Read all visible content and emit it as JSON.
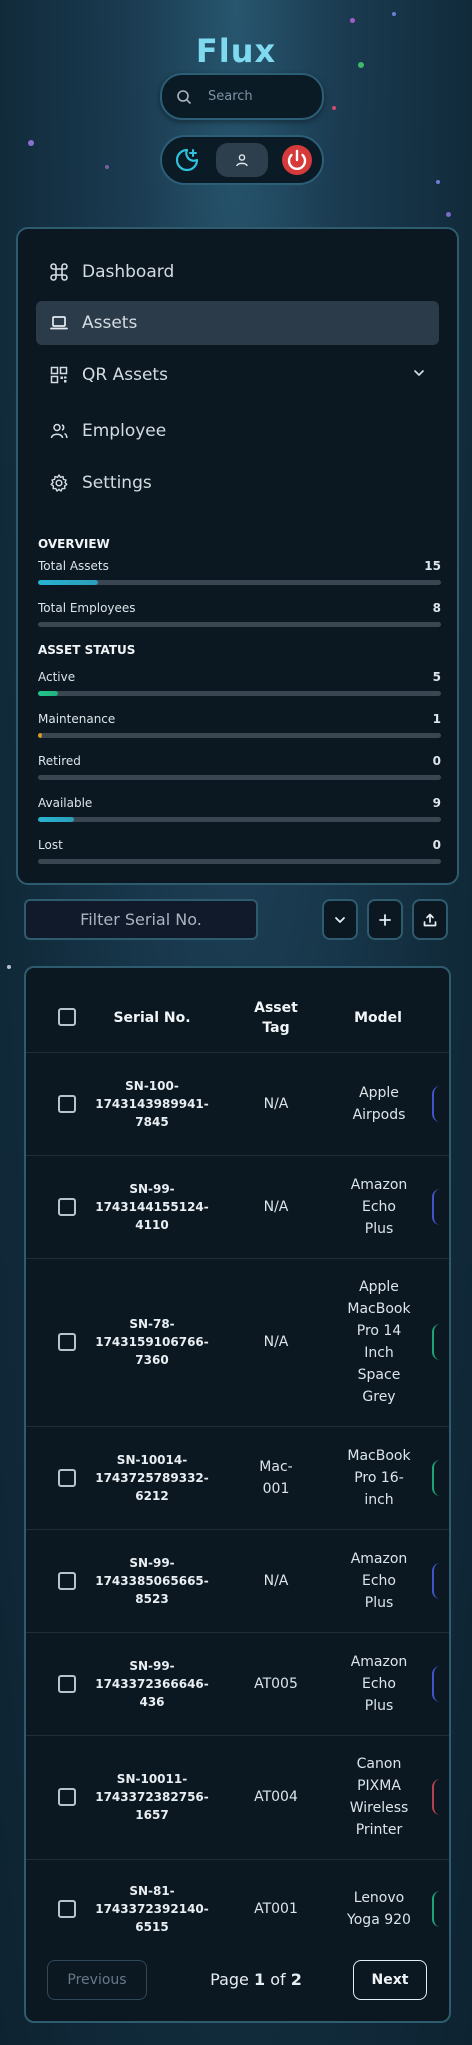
{
  "app": {
    "brand": "Flux"
  },
  "search": {
    "placeholder": "Search"
  },
  "controls": {
    "theme_icon": "moon-plus-icon",
    "profile_icon": "user-icon",
    "power_icon": "power-icon"
  },
  "nav": {
    "items": [
      {
        "label": "Dashboard",
        "icon": "command-icon",
        "active": false
      },
      {
        "label": "Assets",
        "icon": "laptop-icon",
        "active": true
      },
      {
        "label": "QR Assets",
        "icon": "qr-code-icon",
        "active": false,
        "expandable": true
      },
      {
        "label": "Employee",
        "icon": "users-icon",
        "active": false
      },
      {
        "label": "Settings",
        "icon": "gear-icon",
        "active": false
      }
    ]
  },
  "overview": {
    "title": "OVERVIEW",
    "stats": [
      {
        "label": "Total Assets",
        "value": "15",
        "fraction": 0.15,
        "color": "#27b4d3"
      },
      {
        "label": "Total Employees",
        "value": "8",
        "fraction": 0,
        "color": "#27b4d3"
      }
    ]
  },
  "asset_status": {
    "title": "ASSET STATUS",
    "stats": [
      {
        "label": "Active",
        "value": "5",
        "fraction": 0.05,
        "color": "#1fc98a"
      },
      {
        "label": "Maintenance",
        "value": "1",
        "fraction": 0.01,
        "color": "#e8a11b"
      },
      {
        "label": "Retired",
        "value": "0",
        "fraction": 0,
        "color": "#8a8f94"
      },
      {
        "label": "Available",
        "value": "9",
        "fraction": 0.09,
        "color": "#27b4d3"
      },
      {
        "label": "Lost",
        "value": "0",
        "fraction": 0,
        "color": "#e05252"
      }
    ]
  },
  "filter": {
    "placeholder": "Filter Serial No."
  },
  "toolbar": {
    "dropdown_icon": "chevron-down-icon",
    "add_icon": "plus-icon",
    "export_icon": "upload-icon"
  },
  "table": {
    "headers": {
      "serial": "Serial No.",
      "tag_line1": "Asset",
      "tag_line2": "Tag",
      "model": "Model"
    },
    "rows": [
      {
        "serial": [
          "SN-100-",
          "1743143989941-",
          "7845"
        ],
        "tag": [
          "N/A"
        ],
        "model": [
          "Apple",
          "Airpods"
        ],
        "edge": "#4254c8"
      },
      {
        "serial": [
          "SN-99-",
          "1743144155124-",
          "4110"
        ],
        "tag": [
          "N/A"
        ],
        "model": [
          "Amazon",
          "Echo",
          "Plus"
        ],
        "edge": "#4254c8"
      },
      {
        "serial": [
          "SN-78-",
          "1743159106766-",
          "7360"
        ],
        "tag": [
          "N/A"
        ],
        "model": [
          "Apple",
          "MacBook",
          "Pro 14",
          "Inch",
          "Space",
          "Grey"
        ],
        "edge": "#1fa37a"
      },
      {
        "serial": [
          "SN-10014-",
          "1743725789332-",
          "6212"
        ],
        "tag": [
          "Mac-",
          "001"
        ],
        "model": [
          "MacBook",
          "Pro 16-",
          "inch"
        ],
        "edge": "#1fa37a"
      },
      {
        "serial": [
          "SN-99-",
          "1743385065665-",
          "8523"
        ],
        "tag": [
          "N/A"
        ],
        "model": [
          "Amazon",
          "Echo",
          "Plus"
        ],
        "edge": "#4254c8"
      },
      {
        "serial": [
          "SN-99-",
          "1743372366646-",
          "436"
        ],
        "tag": [
          "AT005"
        ],
        "model": [
          "Amazon",
          "Echo",
          "Plus"
        ],
        "edge": "#4254c8"
      },
      {
        "serial": [
          "SN-10011-",
          "1743372382756-",
          "1657"
        ],
        "tag": [
          "AT004"
        ],
        "model": [
          "Canon",
          "PIXMA",
          "Wireless",
          "Printer"
        ],
        "edge": "#b8404e"
      },
      {
        "serial": [
          "SN-81-",
          "1743372392140-",
          "6515"
        ],
        "tag": [
          "AT001"
        ],
        "model": [
          "Lenovo",
          "Yoga 920"
        ],
        "edge": "#1fa37a"
      }
    ]
  },
  "pagination": {
    "previous": "Previous",
    "page_word": "Page",
    "current": "1",
    "of_word": "of",
    "total": "2",
    "next": "Next"
  }
}
